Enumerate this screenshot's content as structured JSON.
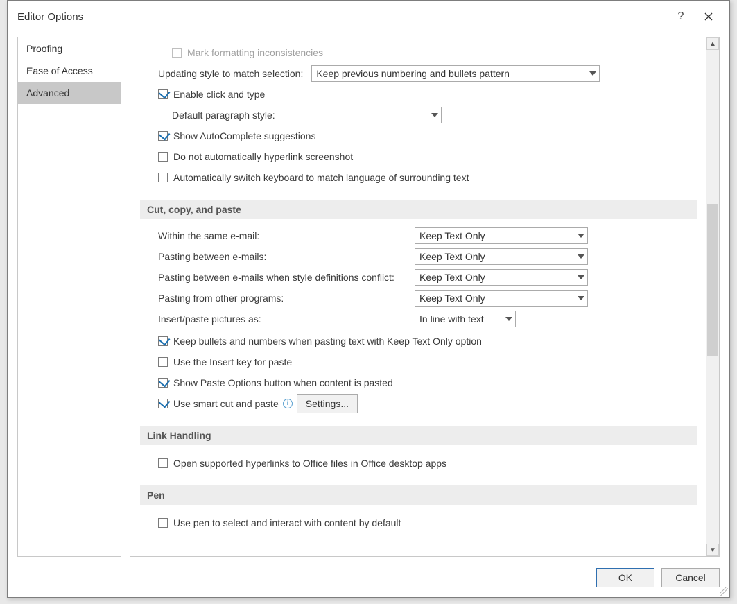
{
  "dialog": {
    "title": "Editor Options"
  },
  "sidebar": {
    "items": [
      {
        "label": "Proofing",
        "selected": false
      },
      {
        "label": "Ease of Access",
        "selected": false
      },
      {
        "label": "Advanced",
        "selected": true
      }
    ]
  },
  "editing": {
    "mark_formatting_label": "Mark formatting inconsistencies",
    "updating_style_label": "Updating style to match selection:",
    "updating_style_value": "Keep previous numbering and bullets pattern",
    "enable_click_type_label": "Enable click and type",
    "default_paragraph_label": "Default paragraph style:",
    "default_paragraph_value": "",
    "autocomplete_label": "Show AutoComplete suggestions",
    "no_auto_hyperlink_label": "Do not automatically hyperlink screenshot",
    "auto_keyboard_label": "Automatically switch keyboard to match language of surrounding text"
  },
  "ccp": {
    "section_title": "Cut, copy, and paste",
    "within_label": "Within the same e-mail:",
    "within_value": "Keep Text Only",
    "between_label": "Pasting between e-mails:",
    "between_value": "Keep Text Only",
    "conflict_label": "Pasting between e-mails when style definitions conflict:",
    "conflict_value": "Keep Text Only",
    "other_label": "Pasting from other programs:",
    "other_value": "Keep Text Only",
    "insert_pic_label": "Insert/paste pictures as:",
    "insert_pic_value": "In line with text",
    "keep_bullets_label": "Keep bullets and numbers when pasting text with Keep Text Only option",
    "insert_key_label": "Use the Insert key for paste",
    "paste_options_label": "Show Paste Options button when content is pasted",
    "smart_cut_label": "Use smart cut and paste",
    "settings_button": "Settings..."
  },
  "link": {
    "section_title": "Link Handling",
    "open_office_label": "Open supported hyperlinks to Office files in Office desktop apps"
  },
  "pen": {
    "section_title": "Pen",
    "use_pen_label": "Use pen to select and interact with content by default"
  },
  "footer": {
    "ok": "OK",
    "cancel": "Cancel"
  }
}
